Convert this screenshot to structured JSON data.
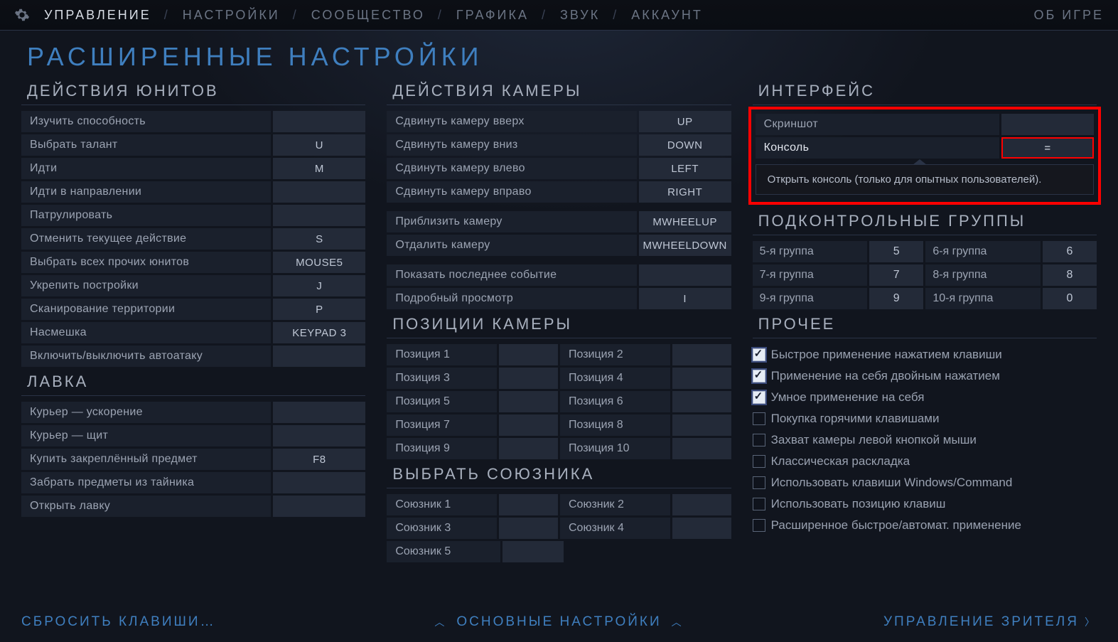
{
  "nav": {
    "items": [
      "УПРАВЛЕНИЕ",
      "НАСТРОЙКИ",
      "СООБЩЕСТВО",
      "ГРАФИКА",
      "ЗВУК",
      "АККАУНТ"
    ],
    "active": 0,
    "right": "ОБ ИГРЕ"
  },
  "title": "РАСШИРЕННЫЕ НАСТРОЙКИ",
  "col1": {
    "unit_h": "ДЕЙСТВИЯ ЮНИТОВ",
    "unit": [
      {
        "l": "Изучить способность",
        "k": ""
      },
      {
        "l": "Выбрать талант",
        "k": "U"
      },
      {
        "l": "Идти",
        "k": "M"
      },
      {
        "l": "Идти в направлении",
        "k": ""
      },
      {
        "l": "Патрулировать",
        "k": ""
      },
      {
        "l": "Отменить текущее действие",
        "k": "S"
      },
      {
        "l": "Выбрать всех прочих юнитов",
        "k": "MOUSE5"
      },
      {
        "l": "Укрепить постройки",
        "k": "J"
      },
      {
        "l": "Сканирование территории",
        "k": "P"
      },
      {
        "l": "Насмешка",
        "k": "KEYPAD 3"
      },
      {
        "l": "Включить/выключить автоатаку",
        "k": ""
      }
    ],
    "shop_h": "ЛАВКА",
    "shop": [
      {
        "l": "Курьер — ускорение",
        "k": ""
      },
      {
        "l": "Курьер — щит",
        "k": ""
      },
      {
        "l": "Купить закреплённый предмет",
        "k": "F8"
      },
      {
        "l": "Забрать предметы из тайника",
        "k": ""
      },
      {
        "l": "Открыть лавку",
        "k": ""
      }
    ]
  },
  "col2": {
    "cam_h": "ДЕЙСТВИЯ КАМЕРЫ",
    "cam": [
      {
        "l": "Сдвинуть камеру вверх",
        "k": "UP"
      },
      {
        "l": "Сдвинуть камеру вниз",
        "k": "DOWN"
      },
      {
        "l": "Сдвинуть камеру влево",
        "k": "LEFT"
      },
      {
        "l": "Сдвинуть камеру вправо",
        "k": "RIGHT"
      }
    ],
    "zoom": [
      {
        "l": "Приблизить камеру",
        "k": "MWHEELUP"
      },
      {
        "l": "Отдалить камеру",
        "k": "MWHEELDOWN"
      }
    ],
    "misc": [
      {
        "l": "Показать последнее событие",
        "k": ""
      },
      {
        "l": "Подробный просмотр",
        "k": "I"
      }
    ],
    "pos_h": "ПОЗИЦИИ КАМЕРЫ",
    "pos": [
      "Позиция 1",
      "Позиция 2",
      "Позиция 3",
      "Позиция 4",
      "Позиция 5",
      "Позиция 6",
      "Позиция 7",
      "Позиция 8",
      "Позиция 9",
      "Позиция 10"
    ],
    "ally_h": "ВЫБРАТЬ СОЮЗНИКА",
    "ally": [
      "Союзник 1",
      "Союзник 2",
      "Союзник 3",
      "Союзник 4",
      "Союзник 5"
    ]
  },
  "col3": {
    "iface_h": "ИНТЕРФЕЙС",
    "screenshot": {
      "l": "Скриншот",
      "k": ""
    },
    "console": {
      "l": "Консоль",
      "k": "="
    },
    "tooltip": "Открыть консоль (только для опытных пользователей).",
    "cg_h": "ПОДКОНТРОЛЬНЫЕ ГРУППЫ",
    "cg": [
      {
        "l": "5-я группа",
        "k": "5"
      },
      {
        "l": "6-я группа",
        "k": "6"
      },
      {
        "l": "7-я группа",
        "k": "7"
      },
      {
        "l": "8-я группа",
        "k": "8"
      },
      {
        "l": "9-я группа",
        "k": "9"
      },
      {
        "l": "10-я группа",
        "k": "0"
      }
    ],
    "other_h": "ПРОЧЕЕ",
    "other": [
      {
        "t": "Быстрое применение нажатием клавиши",
        "c": true
      },
      {
        "t": "Применение на себя двойным нажатием",
        "c": true
      },
      {
        "t": "Умное применение на себя",
        "c": true
      },
      {
        "t": "Покупка горячими клавишами",
        "c": false
      },
      {
        "t": "Захват камеры левой кнопкой мыши",
        "c": false
      },
      {
        "t": "Классическая раскладка",
        "c": false
      },
      {
        "t": "Использовать клавиши Windows/Command",
        "c": false
      },
      {
        "t": "Использовать позицию клавиш",
        "c": false
      },
      {
        "t": "Расширенное быстрое/автомат. применение",
        "c": false
      }
    ]
  },
  "foot": {
    "left": "СБРОСИТЬ КЛАВИШИ…",
    "center": "ОСНОВНЫЕ НАСТРОЙКИ",
    "right": "УПРАВЛЕНИЕ ЗРИТЕЛЯ"
  }
}
